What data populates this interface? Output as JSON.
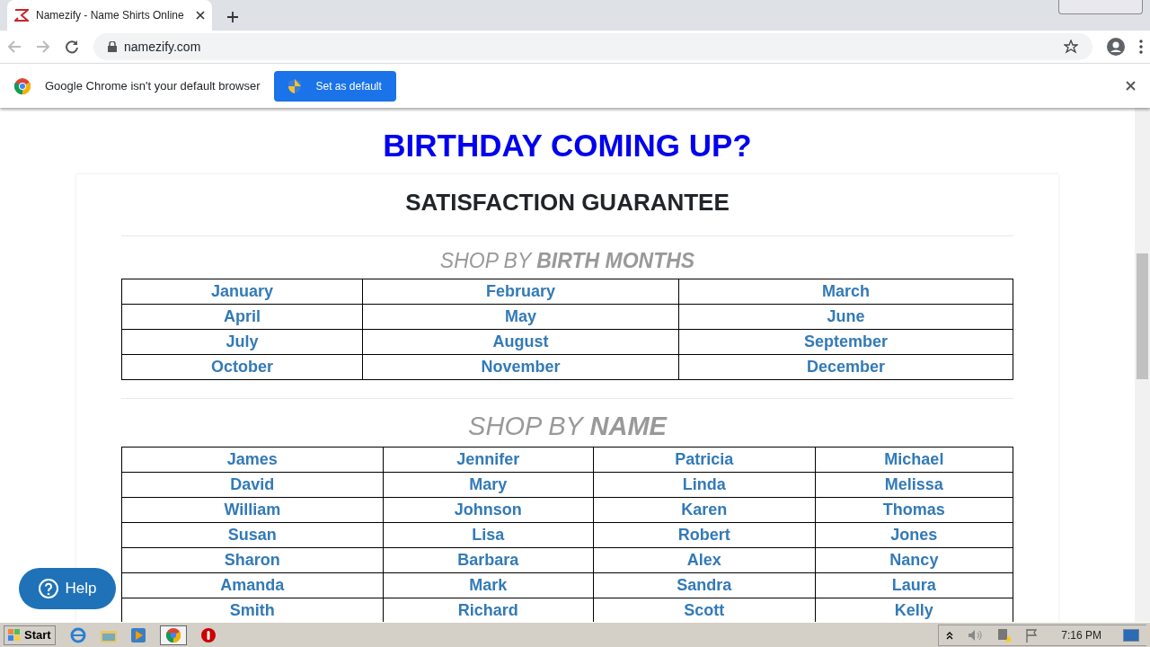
{
  "browser": {
    "tab": {
      "title": "Namezify - Name Shirts Online",
      "selected": true
    },
    "address": "namezify.com"
  },
  "infobar": {
    "message": "Google Chrome isn't your default browser",
    "button": "Set as default"
  },
  "page": {
    "heading": "BIRTHDAY COMING UP?",
    "subheading": "SATISFACTION GUARANTEE",
    "months_title": "SHOP BY **BIRTH MONTHS**",
    "months": [
      [
        "January",
        "February",
        "March"
      ],
      [
        "April",
        "May",
        "June"
      ],
      [
        "July",
        "August",
        "September"
      ],
      [
        "October",
        "November",
        "December"
      ]
    ],
    "names_title": "SHOP BY **NAME**",
    "names": [
      [
        "James",
        "Jennifer",
        "Patricia",
        "Michael"
      ],
      [
        "David",
        "Mary",
        "Linda",
        "Melissa"
      ],
      [
        "William",
        "Johnson",
        "Karen",
        "Thomas"
      ],
      [
        "Susan",
        "Lisa",
        "Robert",
        "Jones"
      ],
      [
        "Sharon",
        "Barbara",
        "Alex",
        "Nancy"
      ],
      [
        "Amanda",
        "Mark",
        "Sandra",
        "Laura"
      ],
      [
        "Smith",
        "Richard",
        "Scott",
        "Kelly"
      ]
    ],
    "help_button": "Help"
  },
  "taskbar": {
    "start": "Start",
    "clock": "7:16 PM"
  }
}
